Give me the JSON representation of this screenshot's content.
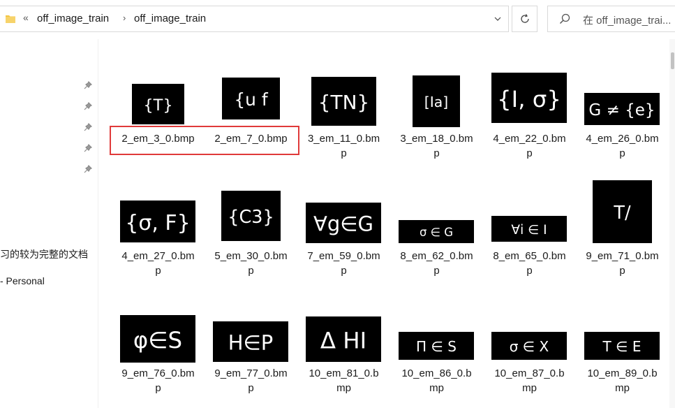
{
  "address": {
    "overflow_glyph": "«",
    "crumbs": [
      "off_image_train",
      "off_image_train"
    ],
    "sep_glyph": "›"
  },
  "search": {
    "placeholder": "在 off_image_trai..."
  },
  "nav": {
    "items": [
      "习的较为完整的文档",
      "- Personal"
    ]
  },
  "files": [
    {
      "line1": "2_em_3_0.bmp",
      "line2": "",
      "glyph": "{T}"
    },
    {
      "line1": "2_em_7_0.bmp",
      "line2": "",
      "glyph": "{u f"
    },
    {
      "line1": "3_em_11_0.bm",
      "line2": "p",
      "glyph": "{TN}"
    },
    {
      "line1": "3_em_18_0.bm",
      "line2": "p",
      "glyph": "[Ia]"
    },
    {
      "line1": "4_em_22_0.bm",
      "line2": "p",
      "glyph": "{I, σ}"
    },
    {
      "line1": "4_em_26_0.bm",
      "line2": "p",
      "glyph": "G ≠ {e}"
    },
    {
      "line1": "4_em_27_0.bm",
      "line2": "p",
      "glyph": "{σ, F}"
    },
    {
      "line1": "5_em_30_0.bm",
      "line2": "p",
      "glyph": "{C3}"
    },
    {
      "line1": "7_em_59_0.bm",
      "line2": "p",
      "glyph": "∀g∈G"
    },
    {
      "line1": "8_em_62_0.bm",
      "line2": "p",
      "glyph": "σ ∈ G"
    },
    {
      "line1": "8_em_65_0.bm",
      "line2": "p",
      "glyph": "∀i ∈ I"
    },
    {
      "line1": "9_em_71_0.bm",
      "line2": "p",
      "glyph": "T/"
    },
    {
      "line1": "9_em_76_0.bm",
      "line2": "p",
      "glyph": "φ∈S"
    },
    {
      "line1": "9_em_77_0.bm",
      "line2": "p",
      "glyph": "H∈P"
    },
    {
      "line1": "10_em_81_0.b",
      "line2": "mp",
      "glyph": "Δ HI"
    },
    {
      "line1": "10_em_86_0.b",
      "line2": "mp",
      "glyph": "Π ∈ S"
    },
    {
      "line1": "10_em_87_0.b",
      "line2": "mp",
      "glyph": "σ ∈ X"
    },
    {
      "line1": "10_em_89_0.b",
      "line2": "mp",
      "glyph": "T ∈ E"
    }
  ],
  "colors": {
    "selection_outline": "#e03a3a",
    "folder": "#f4c542"
  }
}
